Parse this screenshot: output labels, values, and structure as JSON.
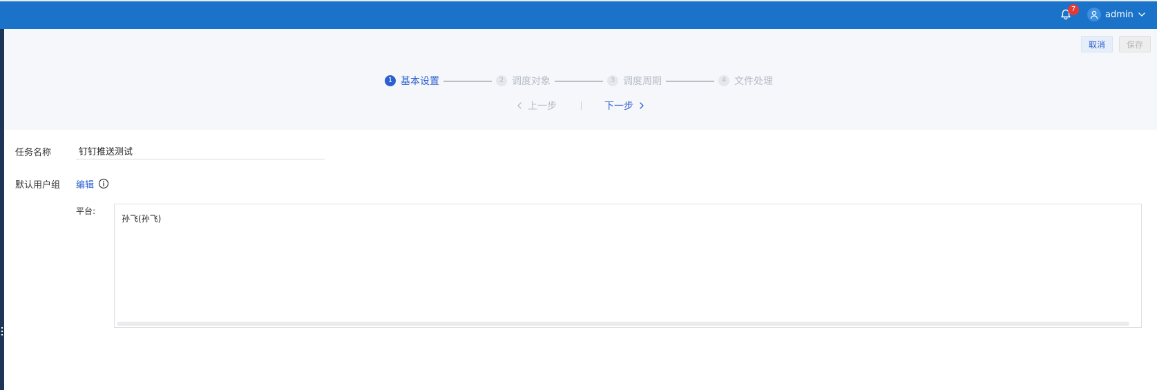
{
  "header": {
    "notification_count": "7",
    "username": "admin"
  },
  "actions": {
    "cancel_label": "取消",
    "save_label": "保存"
  },
  "steps": [
    {
      "number": "1",
      "label": "基本设置",
      "state": "active"
    },
    {
      "number": "2",
      "label": "调度对象",
      "state": "inactive"
    },
    {
      "number": "3",
      "label": "调度周期",
      "state": "inactive"
    },
    {
      "number": "4",
      "label": "文件处理",
      "state": "inactive"
    }
  ],
  "navigation": {
    "prev_label": "上一步",
    "next_label": "下一步"
  },
  "form": {
    "task_name_label": "任务名称",
    "task_name_value": "钉钉推送测试",
    "user_group_label": "默认用户组",
    "edit_label": "编辑",
    "platform_label": "平台:",
    "platform_value": "孙飞(孙飞)"
  },
  "colors": {
    "topbar": "#1a73c8",
    "accent": "#2d5fcf",
    "badge": "#e53935",
    "inactive": "#b6bcc6"
  },
  "icons": {
    "notification": "bell-icon",
    "user": "user-icon",
    "dropdown": "chevron-down-icon",
    "info": "info-icon",
    "prev": "chevron-left-icon",
    "next": "chevron-right-icon"
  }
}
